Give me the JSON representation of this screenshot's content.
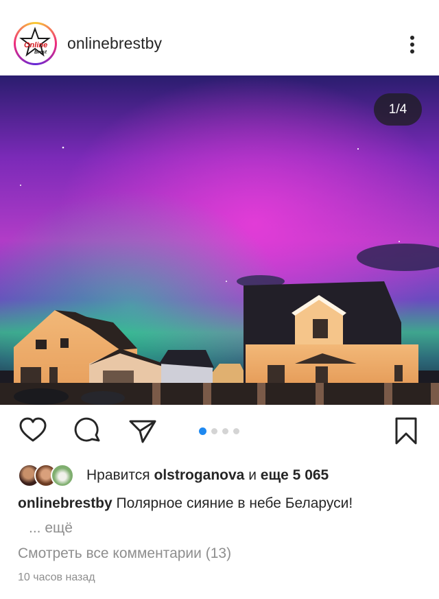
{
  "header": {
    "username": "onlinebrestby",
    "avatar_logo_text": [
      "Online",
      "Brest"
    ],
    "avatar_icon": "star-logo-icon",
    "more_icon": "more-vertical-icon"
  },
  "post": {
    "counter": "1/4",
    "image_icon": "aurora-photo",
    "carousel_total": 4,
    "carousel_active": 1
  },
  "actions": {
    "like_icon": "heart-icon",
    "comment_icon": "comment-icon",
    "share_icon": "send-icon",
    "save_icon": "bookmark-icon"
  },
  "likes": {
    "prefix": "Нравится ",
    "user": "olstroganova",
    "middle": " и ",
    "count": "еще 5 065"
  },
  "caption": {
    "author": "onlinebrestby",
    "text": " Полярное сияние в небе Беларуси!"
  },
  "more_label": "... ещё",
  "comments_label": "Смотреть все комментарии (13)",
  "time_ago": "10 часов назад",
  "colors": {
    "accent": "#1e88f0",
    "text": "#262626",
    "muted": "#8e8e8e"
  }
}
